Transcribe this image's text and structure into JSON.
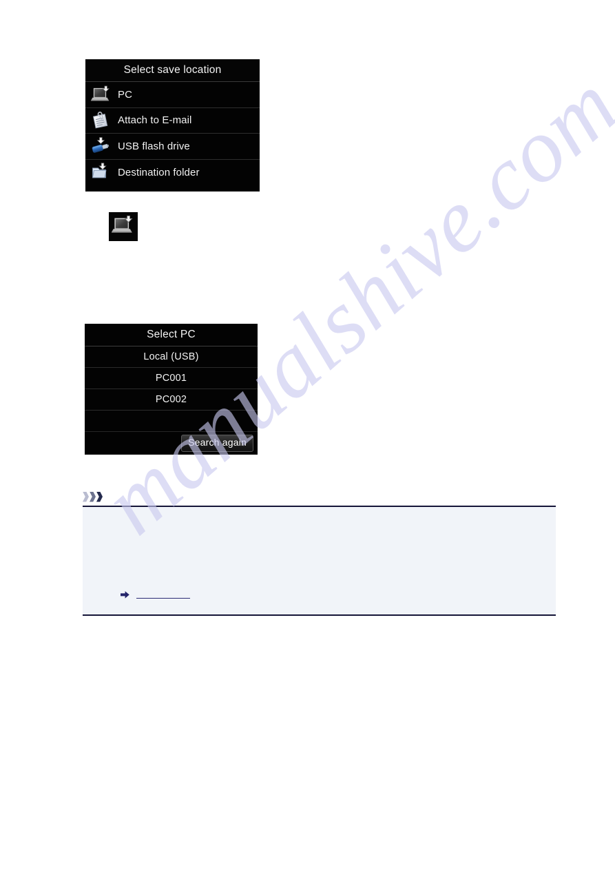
{
  "page": {
    "background_color": "#ffffff",
    "watermark_text": "manualshive.com",
    "watermark_color": "#c9c9ef"
  },
  "panel_save_location": {
    "header": "Select save location",
    "background_color": "#030303",
    "text_color": "#f2f2f2",
    "rows": [
      {
        "label": "PC",
        "icon": "laptop-download-icon"
      },
      {
        "label": "Attach to E-mail",
        "icon": "document-paperclip-icon"
      },
      {
        "label": "USB flash drive",
        "icon": "usb-flash-drive-icon"
      },
      {
        "label": "Destination folder",
        "icon": "folder-download-icon"
      }
    ]
  },
  "standalone_icon": {
    "name": "laptop-download-icon",
    "background_color": "#050505"
  },
  "panel_select_pc": {
    "header": "Select PC",
    "background_color": "#030303",
    "text_color": "#f2f2f2",
    "rows": [
      {
        "label": "Local (USB)"
      },
      {
        "label": "PC001"
      },
      {
        "label": "PC002"
      },
      {
        "label": ""
      }
    ],
    "search_again_label": "Search again"
  },
  "note": {
    "heading": "",
    "chevron_colors": [
      "#b9bcd0",
      "#6d738f",
      "#242a4d"
    ],
    "panel_background": "#f1f4f9",
    "border_color": "#151538",
    "link_text": "",
    "link_color": "#2a2a72",
    "bullet_icon": "arrow-right-icon"
  }
}
